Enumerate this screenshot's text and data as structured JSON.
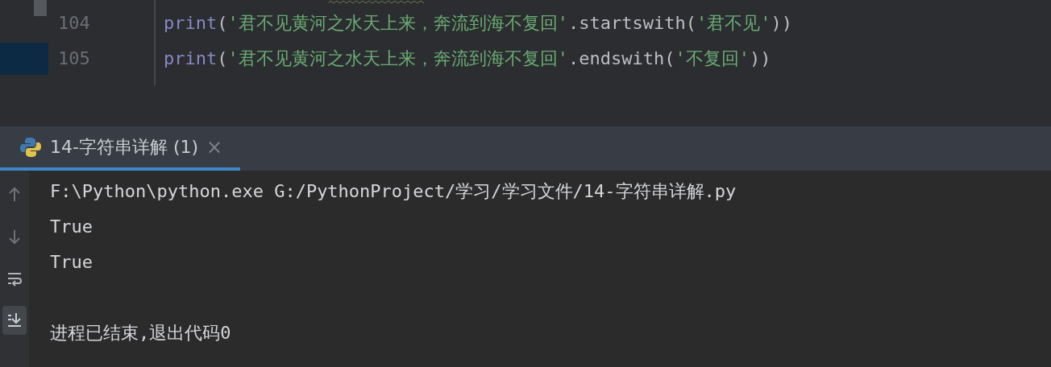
{
  "editor": {
    "lines": [
      {
        "number": "104",
        "current": false,
        "tokens": [
          {
            "kind": "func",
            "text": "print"
          },
          {
            "kind": "punct",
            "text": "("
          },
          {
            "kind": "string",
            "text": "'君不见黄河之水天上来，奔流到海不复回'"
          },
          {
            "kind": "punct",
            "text": "."
          },
          {
            "kind": "method",
            "text": "startswith"
          },
          {
            "kind": "punct",
            "text": "("
          },
          {
            "kind": "string",
            "text": "'君不见'"
          },
          {
            "kind": "punct",
            "text": "))"
          }
        ]
      },
      {
        "number": "105",
        "current": true,
        "tokens": [
          {
            "kind": "func",
            "text": "print"
          },
          {
            "kind": "punct",
            "text": "("
          },
          {
            "kind": "string",
            "text": "'君不见黄河之水天上来，奔流到海不复回'"
          },
          {
            "kind": "punct",
            "text": "."
          },
          {
            "kind": "method",
            "text": "endswith"
          },
          {
            "kind": "punct",
            "text": "("
          },
          {
            "kind": "string",
            "text": "'不复回'"
          },
          {
            "kind": "punct",
            "text": "))"
          }
        ]
      }
    ]
  },
  "run_panel": {
    "tabs": [
      {
        "label": "14-字符串详解 (1)",
        "selected": true,
        "close": "×"
      }
    ],
    "toolbar": [
      {
        "kind": "up",
        "on": false
      },
      {
        "kind": "down",
        "on": false
      },
      {
        "kind": "wrap",
        "on": false
      },
      {
        "kind": "scroll-end",
        "on": true
      }
    ],
    "console": [
      {
        "text": "F:\\Python\\python.exe G:/PythonProject/学习/学习文件/14-字符串详解.py"
      },
      {
        "text": "True"
      },
      {
        "text": "True"
      },
      {
        "text": "进程已结束,退出代码0",
        "gap_before": true
      }
    ]
  }
}
